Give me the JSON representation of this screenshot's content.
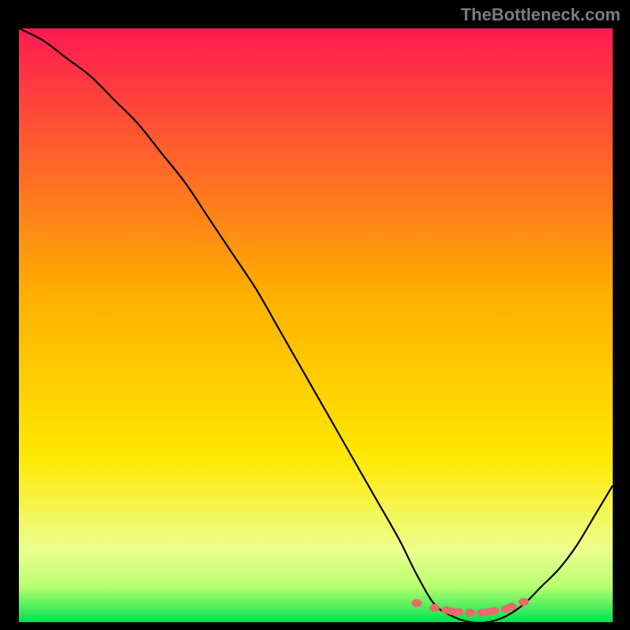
{
  "watermark": "TheBottleneck.com",
  "colors": {
    "bg": "#000000",
    "gradient_top": "#ff1a52",
    "gradient_mid": "#ffd000",
    "gradient_green_light": "#e8ff9a",
    "gradient_green": "#00e24f",
    "curve": "#000000",
    "marker": "#e96a6a"
  },
  "chart_data": {
    "type": "line",
    "title": "",
    "xlabel": "",
    "ylabel": "",
    "xlim": [
      0,
      100
    ],
    "ylim": [
      0,
      100
    ],
    "curve": {
      "x": [
        0,
        4,
        8,
        12,
        16,
        20,
        24,
        28,
        32,
        36,
        40,
        44,
        48,
        52,
        56,
        60,
        64,
        67,
        70,
        73,
        76,
        79,
        82,
        85,
        88,
        91,
        94,
        97,
        100
      ],
      "y": [
        100,
        98,
        95,
        92,
        88,
        84,
        79,
        74,
        68,
        62,
        56,
        49,
        42,
        35,
        28,
        21,
        14,
        8,
        3,
        1,
        0,
        0,
        1,
        3,
        6,
        9,
        13,
        18,
        23
      ]
    },
    "markers": {
      "x": [
        67,
        70,
        72,
        73,
        74,
        76,
        78,
        79,
        80,
        82,
        83,
        85
      ],
      "y": [
        3.2,
        2.4,
        2.0,
        1.8,
        1.7,
        1.6,
        1.6,
        1.7,
        1.9,
        2.2,
        2.6,
        3.4
      ]
    }
  }
}
